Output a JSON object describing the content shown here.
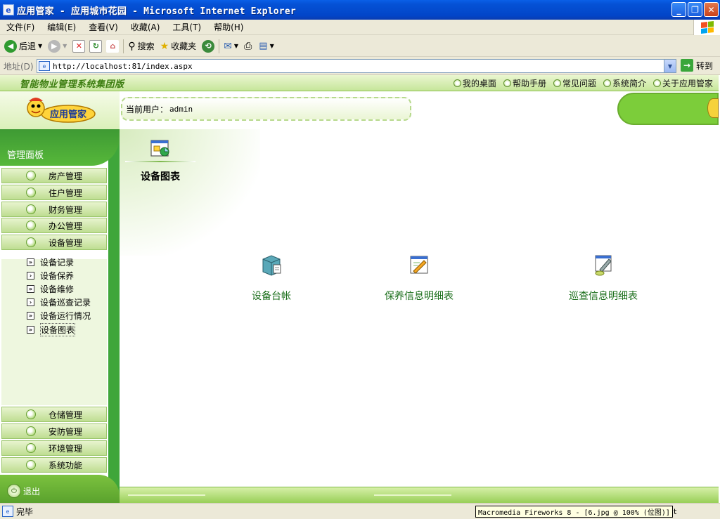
{
  "window": {
    "title": "应用管家 - 应用城市花园 - Microsoft Internet Explorer",
    "minimize": "_",
    "restore": "❐",
    "close": "✕"
  },
  "menubar": {
    "items": [
      "文件(F)",
      "编辑(E)",
      "查看(V)",
      "收藏(A)",
      "工具(T)",
      "帮助(H)"
    ]
  },
  "toolbar": {
    "back": "后退",
    "search": "搜索",
    "favorites": "收藏夹"
  },
  "address": {
    "label": "地址(D)",
    "url": "http://localhost:81/index.aspx",
    "go": "转到"
  },
  "site": {
    "brand": "智能物业管理系统集团版",
    "toplinks": [
      "我的桌面",
      "帮助手册",
      "常见问题",
      "系统简介",
      "关于应用管家"
    ],
    "logo_text": "应用管家",
    "current_user_label": "当前用户：",
    "current_user": "admin"
  },
  "sidebar": {
    "panel_title": "管理面板",
    "nav_top": [
      "房产管理",
      "住户管理",
      "财务管理",
      "办公管理",
      "设备管理"
    ],
    "sub_items": [
      "设备记录",
      "设备保养",
      "设备维修",
      "设备巡查记录",
      "设备运行情况",
      "设备图表"
    ],
    "active_sub": "设备图表",
    "nav_bottom": [
      "仓储管理",
      "安防管理",
      "环境管理",
      "系统功能"
    ],
    "logout": "退出"
  },
  "main": {
    "current_title": "设备图表",
    "cards": [
      "设备台帐",
      "保养信息明细表",
      "巡查信息明细表"
    ]
  },
  "status": {
    "text": "完毕",
    "tooltip": "Macromedia Fireworks 8 - [6.jpg @ 100% (位图)]",
    "tooltip_tail": "t"
  }
}
